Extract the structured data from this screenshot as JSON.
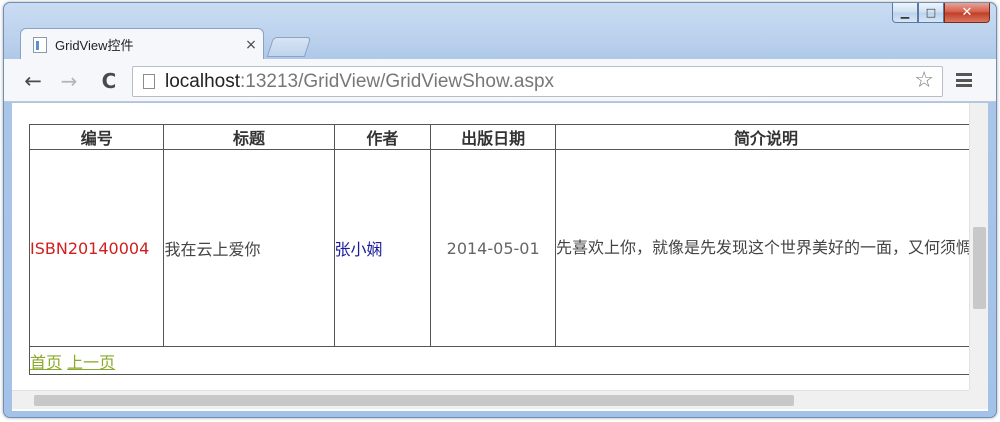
{
  "window": {
    "controls": {
      "minimize": "▁",
      "maximize": "□",
      "close": "✕"
    }
  },
  "tab": {
    "title": "GridView控件",
    "close": "×"
  },
  "toolbar": {
    "back_icon": "←",
    "forward_icon": "→",
    "reload_icon": "C",
    "url_host": "localhost",
    "url_rest": ":13213/GridView/GridViewShow.aspx",
    "star_icon": "☆"
  },
  "grid": {
    "headers": [
      "编号",
      "标题",
      "作者",
      "出版日期",
      "简介说明"
    ],
    "rows": [
      {
        "isbn": "ISBN20140004",
        "title": "我在云上爱你",
        "author": "张小娴",
        "date": "2014-05-01",
        "desc": "先喜欢上你，就像是先发现这个世界美好的一面，又何须惆怅？"
      }
    ],
    "pager": {
      "first": "首页",
      "prev": "上一页"
    }
  },
  "colors": {
    "isbn": "#d11e1e",
    "author": "#1a1a9a",
    "pager_link": "#8aaa2b"
  }
}
